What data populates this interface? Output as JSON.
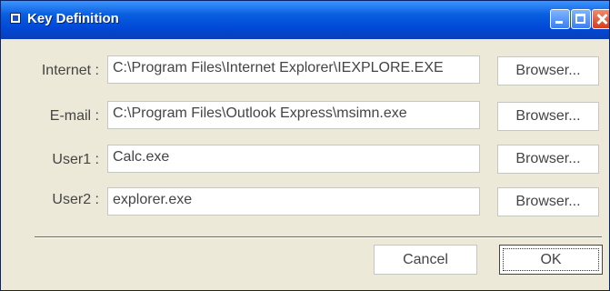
{
  "window": {
    "title": "Key Definition"
  },
  "rows": [
    {
      "label": "Internet :",
      "value": "C:\\Program Files\\Internet Explorer\\IEXPLORE.EXE",
      "button": "Browser..."
    },
    {
      "label": "E-mail :",
      "value": "C:\\Program Files\\Outlook Express\\msimn.exe",
      "button": "Browser..."
    },
    {
      "label": "User1 :",
      "value": "Calc.exe",
      "button": "Browser..."
    },
    {
      "label": "User2 :",
      "value": "explorer.exe",
      "button": "Browser..."
    }
  ],
  "footer": {
    "cancel_label": "Cancel",
    "ok_label": "OK"
  }
}
